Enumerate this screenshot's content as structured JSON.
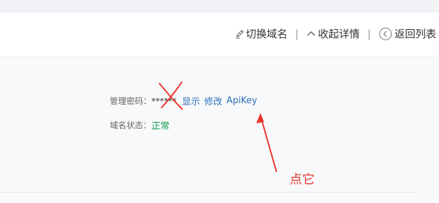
{
  "header": {
    "actions": [
      {
        "label": "切换域名",
        "icon": "pencil-icon"
      },
      {
        "label": "收起详情",
        "icon": "chevron-up-icon"
      },
      {
        "label": "返回列表",
        "icon": "circle-arrow-left-icon"
      }
    ],
    "separator": "|"
  },
  "details": {
    "password_label": "管理密码：",
    "password_masked": "******",
    "show_link": "显示",
    "edit_link": "修改",
    "apikey_link": "ApiKey",
    "status_label": "域名状态：",
    "status_value": "正常"
  },
  "annotation": {
    "text": "点它",
    "color": "#e8352c"
  },
  "colors": {
    "link": "#2b6eb6",
    "status_ok": "#139a4f"
  }
}
